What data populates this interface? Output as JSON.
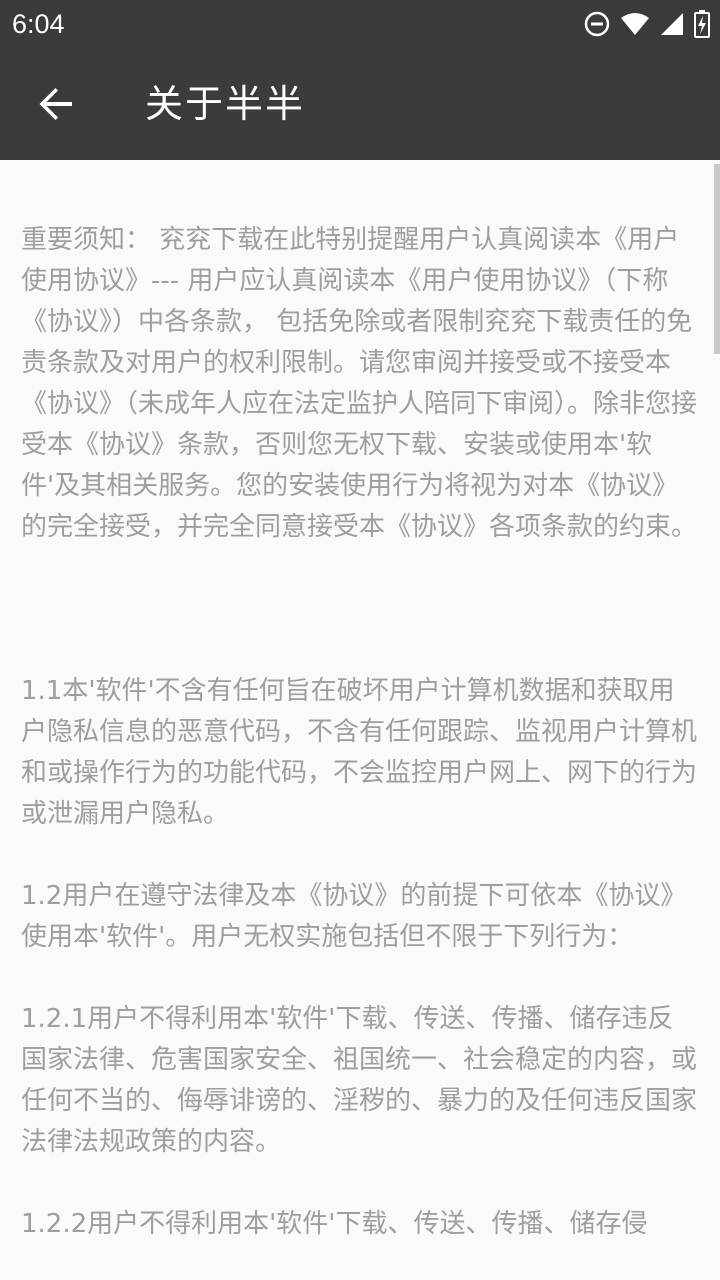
{
  "status_bar": {
    "time": "6:04",
    "icons": [
      "do-not-disturb-icon",
      "wifi-icon",
      "signal-icon",
      "battery-icon"
    ]
  },
  "app_bar": {
    "title": "关于半半",
    "back_icon": "arrow-left-icon"
  },
  "article": {
    "intro": "重要须知： 兖兖下载在此特别提醒用户认真阅读本《用户使用协议》--- 用户应认真阅读本《用户使用协议》（下称《协议》）中各条款， 包括免除或者限制兖兖下载责任的免责条款及对用户的权利限制。请您审阅并接受或不接受本《协议》（未成年人应在法定监护人陪同下审阅）。除非您接受本《协议》条款，否则您无权下载、安装或使用本'软件'及其相关服务。您的安装使用行为将视为对本《协议》的完全接受，并完全同意接受本《协议》各项条款的约束。",
    "sections": [
      "1.1本'软件'不含有任何旨在破坏用户计算机数据和获取用户隐私信息的恶意代码，不含有任何跟踪、监视用户计算机和或操作行为的功能代码，不会监控用户网上、网下的行为或泄漏用户隐私。",
      "1.2用户在遵守法律及本《协议》的前提下可依本《协议》使用本'软件'。用户无权实施包括但不限于下列行为：",
      "1.2.1用户不得利用本'软件'下载、传送、传播、储存违反国家法律、危害国家安全、祖国统一、社会稳定的内容，或任何不当的、侮辱诽谤的、淫秽的、暴力的及任何违反国家法律法规政策的内容。",
      "1.2.2用户不得利用本'软件'下载、传送、传播、储存侵"
    ]
  },
  "colors": {
    "app_bar": "#3b3b3b",
    "background": "#fafafa",
    "text": "#9e9e9e",
    "scrollbar": "#c9c9c9"
  }
}
